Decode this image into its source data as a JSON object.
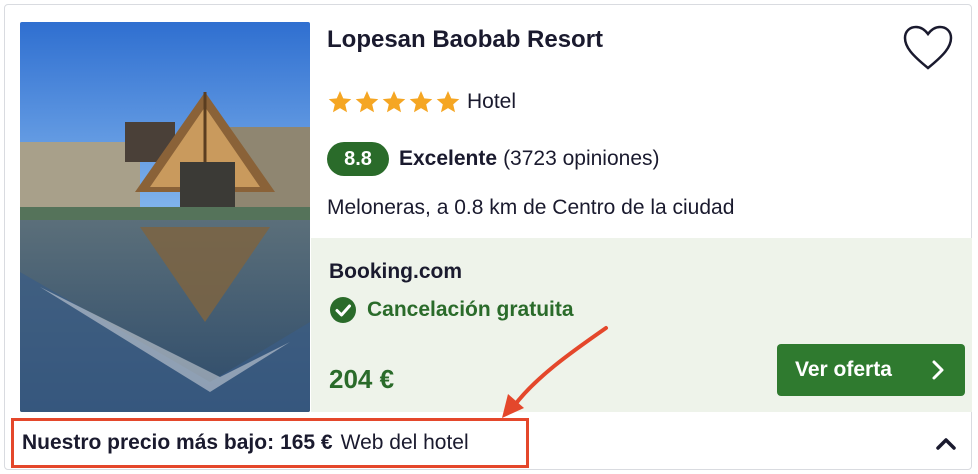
{
  "hotel": {
    "name": "Lopesan Baobab Resort",
    "stars": 5,
    "type": "Hotel",
    "score": "8.8",
    "rating_word": "Excelente",
    "reviews": "(3723 opiniones)",
    "location": "Meloneras, a 0.8 km de Centro de la ciudad"
  },
  "offer": {
    "provider": "Booking.com",
    "cancellation": "Cancelación gratuita",
    "price": "204 €",
    "cta_label": "Ver oferta"
  },
  "lowest_price": {
    "label": "Nuestro precio más bajo:",
    "amount": "165 €",
    "source": "Web del hotel"
  },
  "colors": {
    "accent_green": "#2f7a2f",
    "score_green": "#2a6b2a",
    "star_orange": "#f5a623",
    "offer_bg": "#eef3ea",
    "highlight_red": "#e4472b"
  },
  "icons": [
    "heart-icon",
    "star-icon",
    "check-circle-icon",
    "chevron-right-icon",
    "chevron-up-icon",
    "annotation-arrow"
  ]
}
